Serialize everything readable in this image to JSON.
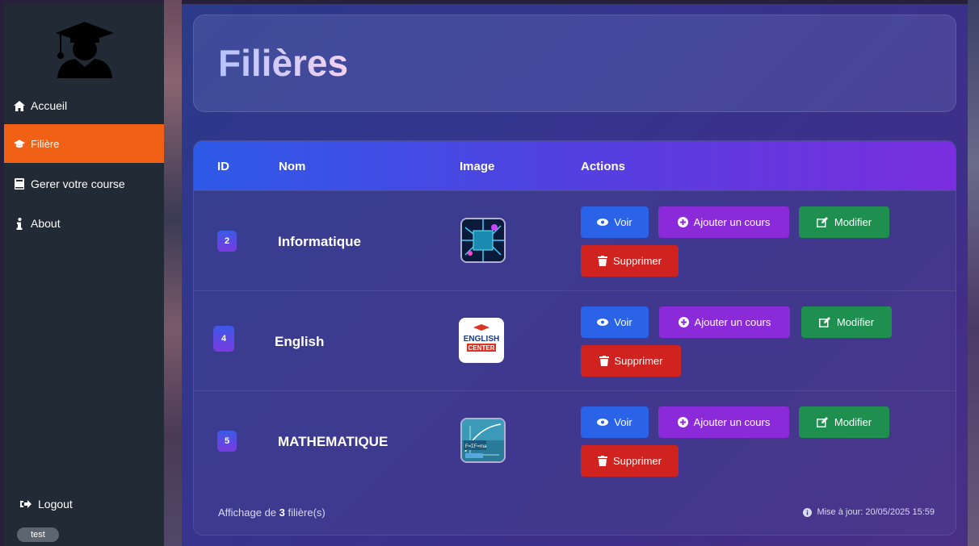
{
  "sidebar": {
    "items": [
      {
        "label": "Accueil",
        "icon": "home-icon"
      },
      {
        "label": "Filière",
        "icon": "graduation-cap-icon"
      },
      {
        "label": "Gerer votre course",
        "icon": "book-icon"
      },
      {
        "label": "About",
        "icon": "info-icon"
      }
    ],
    "logout_label": "Logout",
    "user": "test"
  },
  "page": {
    "title": "Filières"
  },
  "table": {
    "headers": {
      "id": "ID",
      "name": "Nom",
      "image": "Image",
      "actions": "Actions"
    },
    "rows": [
      {
        "id": "2",
        "name": "Informatique",
        "image": "circuit-board-thumbnail"
      },
      {
        "id": "4",
        "name": "English",
        "image": "english-center-logo-thumbnail"
      },
      {
        "id": "5",
        "name": "MATHEMATIQUE",
        "image": "math-formulas-thumbnail"
      }
    ],
    "actions": {
      "view": "Voir",
      "add_course": "Ajouter un cours",
      "edit": "Modifier",
      "delete": "Supprimer"
    },
    "footer": {
      "prefix": "Affichage de ",
      "count": "3",
      "suffix": " filière(s)",
      "updated": "Mise à jour: 20/05/2025 15:59"
    }
  },
  "colors": {
    "sidebar_bg": "#212a35",
    "active_nav": "#f06015",
    "btn_view": "#2a63e8",
    "btn_add": "#8a2ad8",
    "btn_edit": "#1e8f4e",
    "btn_delete": "#d0231f"
  }
}
